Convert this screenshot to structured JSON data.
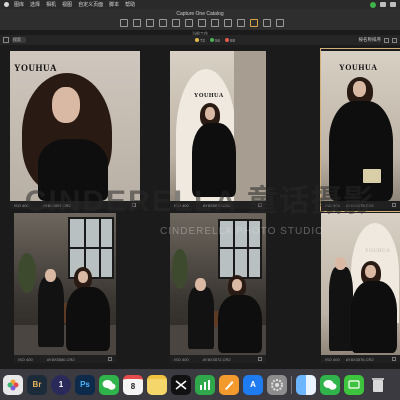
{
  "menubar": {
    "items": [
      "图库",
      "选择",
      "相机",
      "视图",
      "自定义页面",
      "脚本",
      "帮助"
    ]
  },
  "window": {
    "title": "Capture One Catalog",
    "subtitle": "当前工作"
  },
  "filterbar": {
    "search_value": "搜索",
    "counts": [
      {
        "value": "72",
        "color": "#e0b84a"
      },
      {
        "value": "56",
        "color": "#4caf50"
      },
      {
        "value": "88",
        "color": "#e05a4a"
      }
    ],
    "right_label": "按名称排序"
  },
  "photos": [
    {
      "iso": "ISO 400",
      "file": "AY8X5007.CR2"
    },
    {
      "iso": "ISO 400",
      "file": "AY8X5070.CR2"
    },
    {
      "iso": "ISO 400",
      "file": "AY8X5079.CR2"
    },
    {
      "iso": "ISO 400",
      "file": "AY8X5580.CR2"
    },
    {
      "iso": "ISO 400",
      "file": "AY8X3572.CR2"
    },
    {
      "iso": "ISO 400",
      "file": "AY8X3576.CR2"
    }
  ],
  "photo_text": {
    "younhua": "YOUHUA",
    "younhua_white": "YOUHUA"
  },
  "watermark": {
    "main": "CINDERELLA 童话摄影",
    "sub": "CINDERELLA PHOTO STUDIO"
  },
  "dock": {
    "apps": [
      {
        "name": "photos",
        "label": "",
        "color": "#e8e8e8"
      },
      {
        "name": "bridge",
        "label": "Br",
        "color": "#1b2b3a"
      },
      {
        "name": "capture-one",
        "label": "1",
        "color": "#2a2a5a"
      },
      {
        "name": "photoshop",
        "label": "Ps",
        "color": "#0d2a4a"
      },
      {
        "name": "wechat",
        "label": "",
        "color": "#2fb34a"
      },
      {
        "name": "calendar",
        "label": "8",
        "color": "#f4f4f4"
      },
      {
        "name": "notes",
        "label": "",
        "color": "#f5d66a"
      },
      {
        "name": "capcut",
        "label": "",
        "color": "#111111"
      },
      {
        "name": "numbers",
        "label": "",
        "color": "#2ea84a"
      },
      {
        "name": "pages",
        "label": "",
        "color": "#f29a2e"
      },
      {
        "name": "app-store",
        "label": "A",
        "color": "#1e7cf0"
      },
      {
        "name": "system-settings",
        "label": "",
        "color": "#8d8d8d"
      },
      {
        "name": "finder",
        "label": "",
        "color": "#3a8ef0"
      },
      {
        "name": "wechat-2",
        "label": "",
        "color": "#2fb34a"
      },
      {
        "name": "iqiyi",
        "label": "",
        "color": "#3ec33e"
      },
      {
        "name": "trash",
        "label": "",
        "color": "#cfcfcf"
      }
    ]
  }
}
